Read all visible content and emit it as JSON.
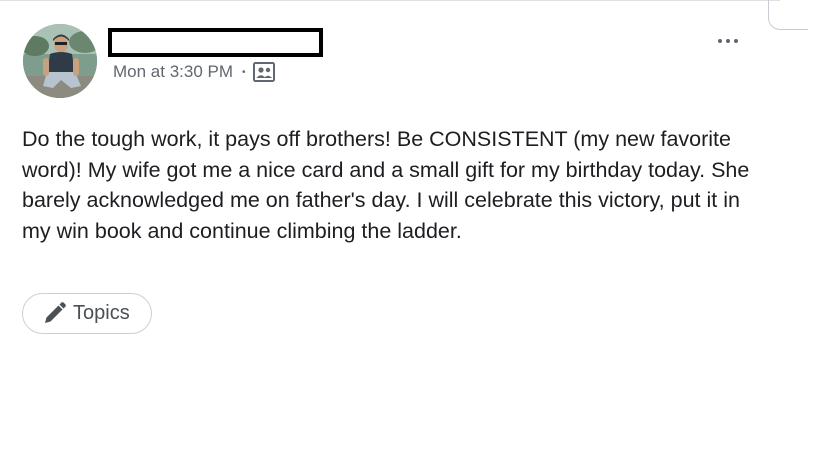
{
  "post": {
    "timestamp": "Mon at 3:30 PM",
    "separator": "•",
    "audience_icon": "group-audience-icon",
    "body": "Do the tough work, it pays off brothers! Be CONSISTENT (my new favorite word)! My wife got me a nice card and a small gift for my birthday today. She barely acknowledged me on father's day. I will celebrate this victory, put it in my win book and continue climbing the ladder.",
    "topics_label": "Topics",
    "topics_icon": "pencil-icon",
    "more_icon": "more-options-icon"
  },
  "colors": {
    "text": "#1c1e21",
    "meta": "#606770",
    "border": "#ccd0d5"
  }
}
